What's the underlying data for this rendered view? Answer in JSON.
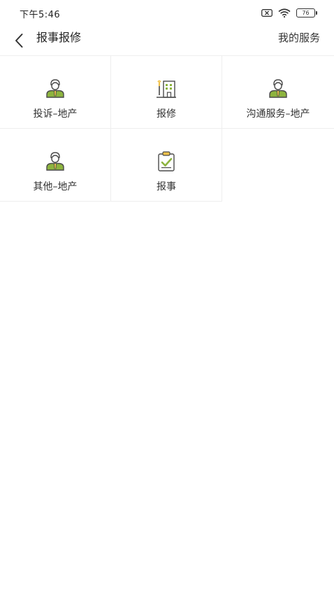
{
  "status": {
    "time": "下午5:46",
    "battery_level": "76"
  },
  "nav": {
    "title": "报事报修",
    "right_label": "我的服务"
  },
  "grid": {
    "items": [
      {
        "label": "投诉–地产",
        "icon": "person-icon"
      },
      {
        "label": "报修",
        "icon": "building-repair-icon"
      },
      {
        "label": "沟通服务–地产",
        "icon": "person-icon"
      },
      {
        "label": "其他–地产",
        "icon": "person-icon"
      },
      {
        "label": "报事",
        "icon": "clipboard-check-icon"
      }
    ]
  },
  "colors": {
    "icon_green": "#8db43f",
    "icon_yellow": "#f2c24b",
    "icon_dark": "#4a4a4a",
    "divider": "#eeeeee"
  }
}
